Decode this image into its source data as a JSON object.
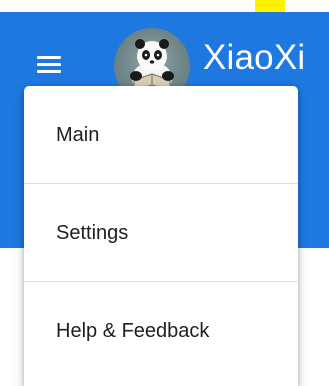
{
  "app": {
    "title": "XiaoXi",
    "menu_icon": "hamburger-menu-icon",
    "avatar_icon": "panda-reading-avatar"
  },
  "menu": {
    "items": [
      {
        "label": "Main"
      },
      {
        "label": "Settings"
      },
      {
        "label": "Help & Feedback"
      }
    ]
  },
  "colors": {
    "appbar": "#1e78e0",
    "highlight": "#fff200",
    "menu_bg": "#ffffff",
    "text": "#1f1f1f"
  }
}
